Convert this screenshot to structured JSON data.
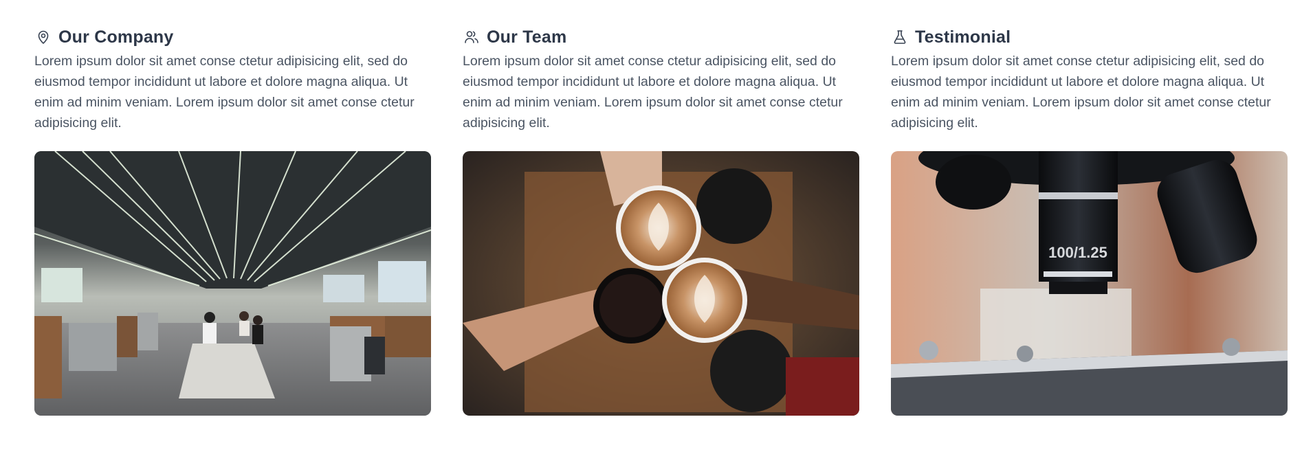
{
  "cards": [
    {
      "icon": "map-pin-icon",
      "title": "Our Company",
      "text": "Lorem ipsum dolor sit amet conse ctetur adipisicing elit, sed do eiusmod tempor incididunt ut labore et dolore magna aliqua. Ut enim ad minim veniam. Lorem ipsum dolor sit amet conse ctetur adipisicing elit.",
      "image": "open-office-photo"
    },
    {
      "icon": "users-icon",
      "title": "Our Team",
      "text": "Lorem ipsum dolor sit amet conse ctetur adipisicing elit, sed do eiusmod tempor incididunt ut labore et dolore magna aliqua. Ut enim ad minim veniam. Lorem ipsum dolor sit amet conse ctetur adipisicing elit.",
      "image": "coffee-cups-toast-photo"
    },
    {
      "icon": "flask-icon",
      "title": "Testimonial",
      "text": "Lorem ipsum dolor sit amet conse ctetur adipisicing elit, sed do eiusmod tempor incididunt ut labore et dolore magna aliqua. Ut enim ad minim veniam. Lorem ipsum dolor sit amet conse ctetur adipisicing elit.",
      "image": "microscope-photo",
      "image_text": "100/1.25"
    }
  ],
  "colors": {
    "title": "#2d3748",
    "text": "#4b5563",
    "background": "#ffffff"
  }
}
